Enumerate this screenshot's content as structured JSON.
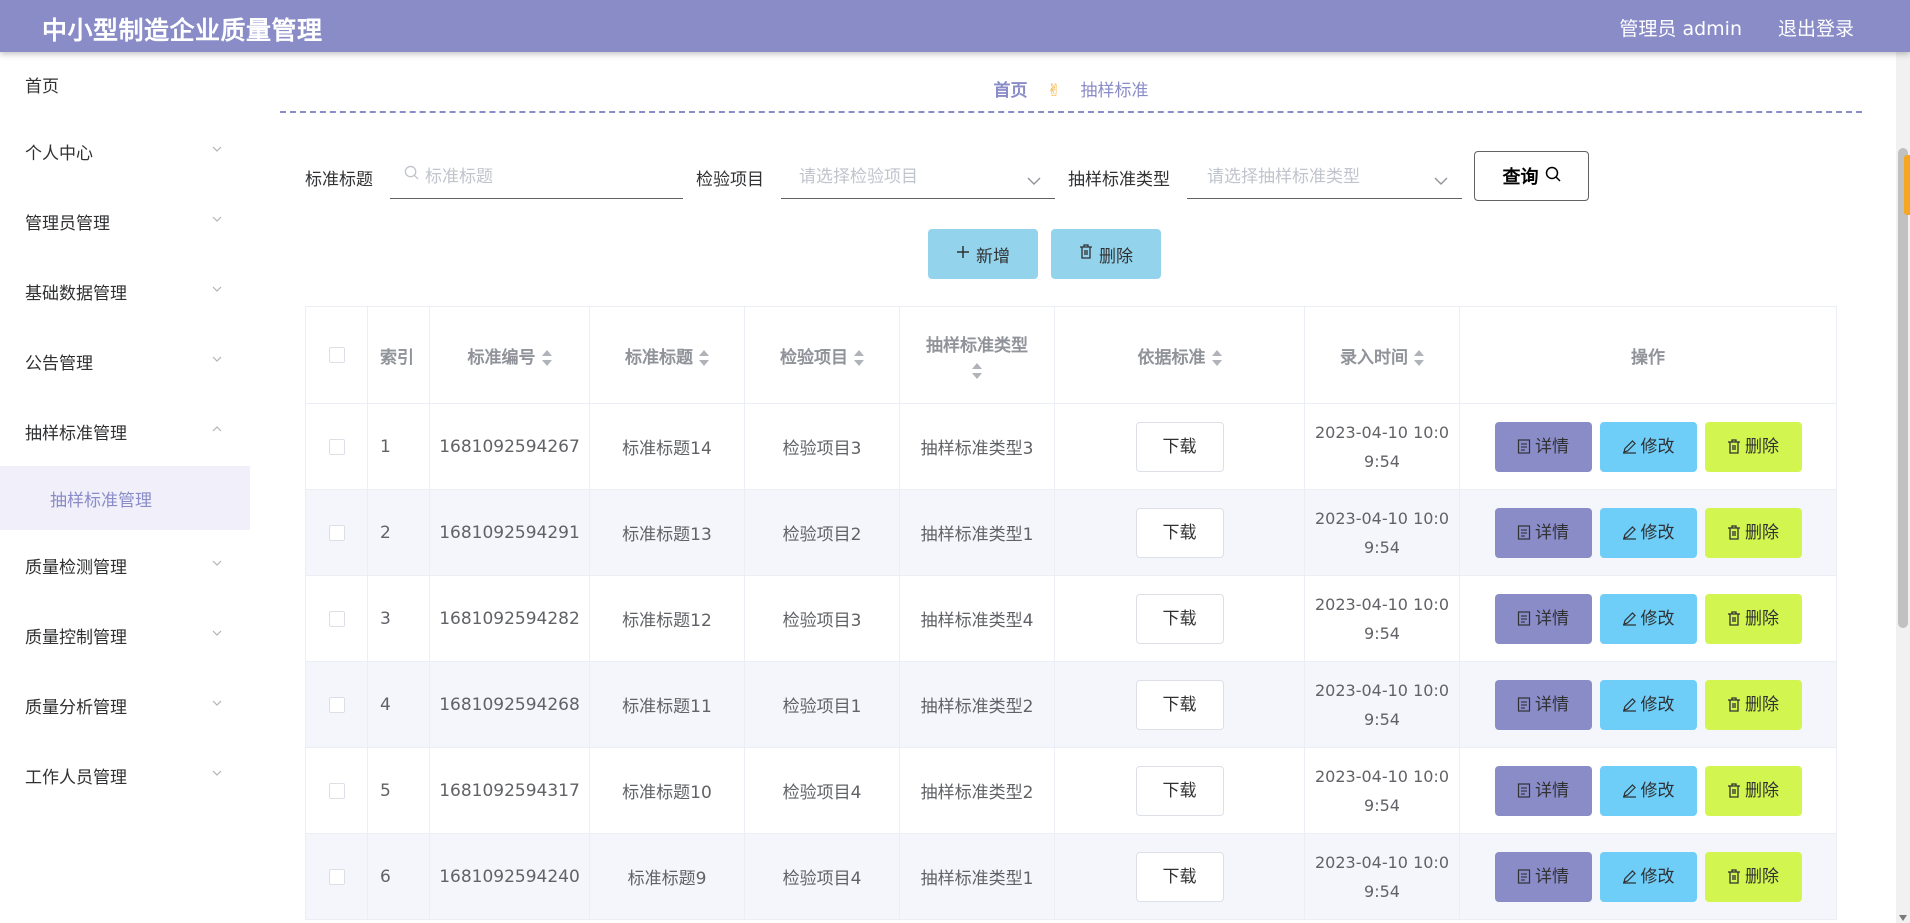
{
  "header": {
    "title": "中小型制造企业质量管理",
    "user": "管理员 admin",
    "logout": "退出登录"
  },
  "sidebar": {
    "items": [
      {
        "label": "首页",
        "chevron": "none"
      },
      {
        "label": "个人中心",
        "chevron": "down"
      },
      {
        "label": "管理员管理",
        "chevron": "down"
      },
      {
        "label": "基础数据管理",
        "chevron": "down"
      },
      {
        "label": "公告管理",
        "chevron": "down"
      },
      {
        "label": "抽样标准管理",
        "chevron": "up"
      },
      {
        "label": "质量检测管理",
        "chevron": "down"
      },
      {
        "label": "质量控制管理",
        "chevron": "down"
      },
      {
        "label": "质量分析管理",
        "chevron": "down"
      },
      {
        "label": "工作人员管理",
        "chevron": "down"
      }
    ],
    "submenu": {
      "label": "抽样标准管理"
    }
  },
  "breadcrumb": {
    "home": "首页",
    "current": "抽样标准"
  },
  "filters": {
    "title_label": "标准标题",
    "title_placeholder": "标准标题",
    "item_label": "检验项目",
    "item_placeholder": "请选择检验项目",
    "type_label": "抽样标准类型",
    "type_placeholder": "请选择抽样标准类型",
    "query": "查询"
  },
  "toolbar": {
    "add": "新增",
    "delete": "删除"
  },
  "table": {
    "headers": {
      "index": "索引",
      "code": "标准编号",
      "title": "标准标题",
      "item": "检验项目",
      "type": "抽样标准类型",
      "basis": "依据标准",
      "time": "录入时间",
      "ops": "操作"
    },
    "download_label": "下载",
    "ops": {
      "detail": "详情",
      "edit": "修改",
      "delete": "删除"
    },
    "rows": [
      {
        "index": "1",
        "code": "1681092594267",
        "title": "标准标题14",
        "item": "检验项目3",
        "type": "抽样标准类型3",
        "time1": "2023-04-10 10:0",
        "time2": "9:54"
      },
      {
        "index": "2",
        "code": "1681092594291",
        "title": "标准标题13",
        "item": "检验项目2",
        "type": "抽样标准类型1",
        "time1": "2023-04-10 10:0",
        "time2": "9:54"
      },
      {
        "index": "3",
        "code": "1681092594282",
        "title": "标准标题12",
        "item": "检验项目3",
        "type": "抽样标准类型4",
        "time1": "2023-04-10 10:0",
        "time2": "9:54"
      },
      {
        "index": "4",
        "code": "1681092594268",
        "title": "标准标题11",
        "item": "检验项目1",
        "type": "抽样标准类型2",
        "time1": "2023-04-10 10:0",
        "time2": "9:54"
      },
      {
        "index": "5",
        "code": "1681092594317",
        "title": "标准标题10",
        "item": "检验项目4",
        "type": "抽样标准类型2",
        "time1": "2023-04-10 10:0",
        "time2": "9:54"
      },
      {
        "index": "6",
        "code": "1681092594240",
        "title": "标准标题9",
        "item": "检验项目4",
        "type": "抽样标准类型1",
        "time1": "2023-04-10 10:0",
        "time2": "9:54"
      }
    ]
  },
  "colors": {
    "primary": "#8a8cc8",
    "info": "#6ecef8",
    "danger": "#d2f550",
    "toolbar": "#94d3ec"
  }
}
